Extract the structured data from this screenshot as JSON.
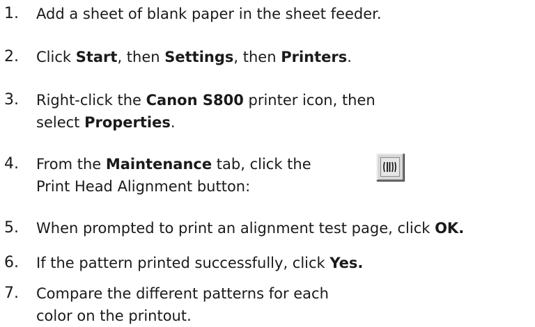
{
  "steps": [
    {
      "number": "1.",
      "text": "Add a sheet of blank paper in the sheet feeder."
    },
    {
      "number": "2.",
      "click": "Click ",
      "start": "Start",
      "then1": ", then ",
      "settings": "Settings",
      "then2": ", then ",
      "printers": "Printers",
      "end": "."
    },
    {
      "number": "3.",
      "pre": "Right-click the ",
      "printer": "Canon S800",
      "post": " printer icon, then",
      "select": "select ",
      "properties": "Properties",
      "end": "."
    },
    {
      "number": "4.",
      "pre": "From the ",
      "tab": "Maintenance",
      "post": " tab, click the",
      "line2": "Print Head Alignment button:"
    },
    {
      "number": "5.",
      "pre": "When prompted to print an alignment test page, click ",
      "ok": "OK."
    },
    {
      "number": "6.",
      "pre": "If the pattern printed successfully, click ",
      "yes": "Yes."
    },
    {
      "number": "7.",
      "line1": "Compare the different patterns for each",
      "line2": "color on the printout."
    }
  ],
  "icons": {
    "print_head_alignment": "print-head-alignment-icon"
  }
}
